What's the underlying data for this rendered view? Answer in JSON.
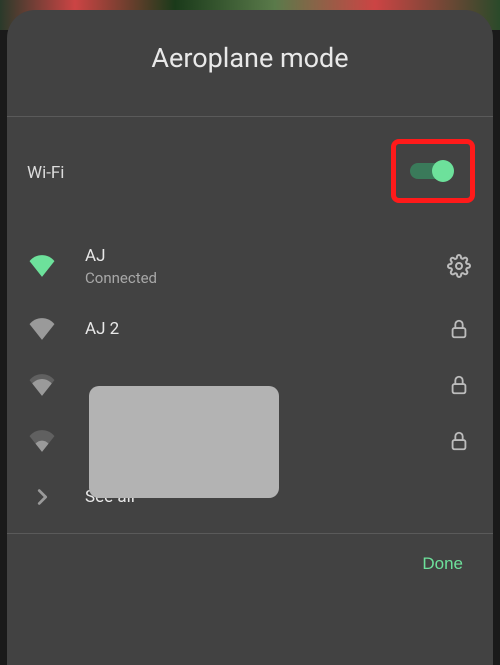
{
  "header": {
    "title": "Aeroplane mode"
  },
  "wifi": {
    "section_label": "Wi-Fi",
    "toggle_on": true,
    "networks": [
      {
        "name": "AJ",
        "status": "Connected",
        "connected": true,
        "locked": false,
        "signal": 4
      },
      {
        "name": "AJ 2",
        "status": "",
        "connected": false,
        "locked": true,
        "signal": 4
      },
      {
        "name": "",
        "status": "",
        "connected": false,
        "locked": true,
        "signal": 3
      },
      {
        "name": "",
        "status": "",
        "connected": false,
        "locked": true,
        "signal": 2
      }
    ],
    "see_all_label": "See all"
  },
  "footer": {
    "done_label": "Done"
  },
  "colors": {
    "accent": "#6de19b",
    "panel": "#424242",
    "highlight": "#ff1a1a"
  }
}
